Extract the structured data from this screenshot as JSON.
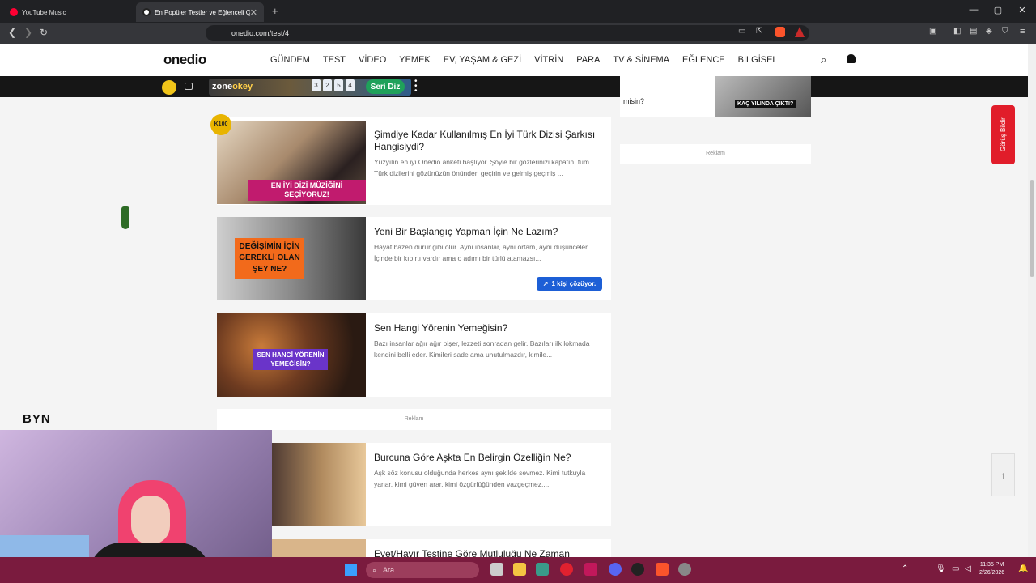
{
  "browser": {
    "tabs": [
      {
        "title": "YouTube Music",
        "active": false
      },
      {
        "title": "En Popüler Testler ve Eğlenceli Q",
        "active": true
      }
    ],
    "url": "onedio.com/test/4"
  },
  "site": {
    "logo": "onedio",
    "nav": [
      "GÜNDEM",
      "TEST",
      "VİDEO",
      "YEMEK",
      "EV, YAŞAM & GEZİ",
      "VİTRİN",
      "PARA",
      "TV & SİNEMA",
      "EĞLENCE",
      "BİLGİSEL"
    ],
    "promo": {
      "brand": "zone",
      "brand_suffix": "okey",
      "tiles": [
        "3",
        "2",
        "5",
        "4"
      ],
      "cta": "Seri Diz"
    }
  },
  "articles": [
    {
      "title": "Şimdiye Kadar Kullanılmış En İyi Türk Dizisi Şarkısı Hangisiydi?",
      "desc": "Yüzyılın en iyi Onedio anketi başlıyor. Şöyle bir gözlerinizi kapatın, tüm Türk dizilerini gözünüzün önünden geçirin ve gelmiş geçmiş ...",
      "thumb_text": "EN İYİ DİZİ MÜZİĞİNİ SEÇİYORUZ!"
    },
    {
      "title": "Yeni Bir Başlangıç Yapman İçin Ne Lazım?",
      "desc": "Hayat bazen durur gibi olur. Aynı insanlar, aynı ortam, aynı düşünceler... İçinde bir kıpırtı vardır ama o adımı bir türlü atamazsı...",
      "thumb_text": "DEĞİŞİMİN İÇİN GEREKLİ OLAN ŞEY NE?",
      "badge": "1 kişi çözüyor."
    },
    {
      "title": "Sen Hangi Yörenin Yemeğisin?",
      "desc": "Bazı insanlar ağır ağır pişer, lezzeti sonradan gelir. Bazıları ilk lokmada kendini belli eder. Kimileri sade ama unutulmazdır, kimile...",
      "thumb_text": "SEN HANGİ YÖRENİN YEMEĞİSİN?"
    },
    {
      "title": "Burcuna Göre Aşkta En Belirgin Özelliğin Ne?",
      "desc": "Aşk söz konusu olduğunda herkes aynı şekilde sevmez. Kimi tutkuyla yanar, kimi güven arar, kimi özgürlüğünden vazgeçmez,..."
    },
    {
      "title": "Evet/Hayır Testine Göre Mutluluğu Ne Zaman"
    }
  ],
  "ad_label": "Reklam",
  "side": {
    "top_text": "misin?",
    "top_thumb_text": "KAÇ YILINDA ÇIKTI?",
    "ad_label": "Reklam"
  },
  "feedback_label": "Görüş Bildir",
  "overlay_text": "BYN",
  "taskbar": {
    "search_placeholder": "Ara",
    "time": "11:35 PM",
    "date": "2/26/2026"
  }
}
